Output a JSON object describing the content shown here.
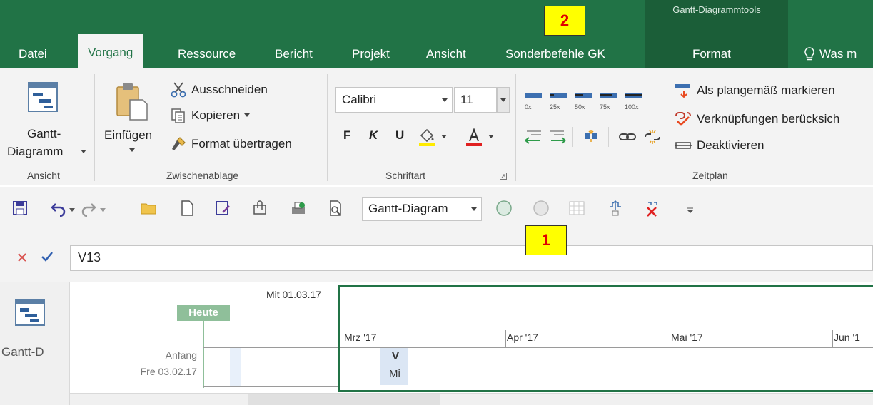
{
  "ribbon": {
    "contextual_title": "Gantt-Diagrammtools",
    "tabs": {
      "datei": "Datei",
      "vorgang": "Vorgang",
      "ressource": "Ressource",
      "bericht": "Bericht",
      "projekt": "Projekt",
      "ansicht": "Ansicht",
      "sonderbefehle": "Sonderbefehle GK",
      "format": "Format",
      "search": "Was m"
    },
    "groups": {
      "ansicht": {
        "label": "Ansicht",
        "gantt_line1": "Gantt-",
        "gantt_line2": "Diagramm"
      },
      "zwischenablage": {
        "label": "Zwischenablage",
        "einfuegen": "Einfügen",
        "ausschneiden": "Ausschneiden",
        "kopieren": "Kopieren",
        "format_uebertragen": "Format übertragen"
      },
      "schriftart": {
        "label": "Schriftart",
        "font_name": "Calibri",
        "font_size": "11",
        "bold": "F",
        "italic": "K",
        "underline": "U"
      },
      "zeitplan": {
        "label": "Zeitplan",
        "pct_labels": [
          "0x",
          "25x",
          "50x",
          "75x",
          "100x"
        ],
        "als_plangemaess": "Als plangemäß markieren",
        "verknuepfungen": "Verknüpfungen berücksich",
        "deaktivieren": "Deaktivieren"
      }
    }
  },
  "qat": {
    "view_select": "Gantt-Diagram"
  },
  "formula": {
    "value": "V13"
  },
  "timeline": {
    "heute": "Heute",
    "top_date": "Mit 01.03.17",
    "months": [
      "Mrz '17",
      "Apr '17",
      "Mai '17",
      "Jun '1"
    ],
    "anfang_label": "Anfang",
    "anfang_date": "Fre 03.02.17",
    "task_letter": "V",
    "task_day": "Mi",
    "side_label": "Gantt-D"
  },
  "annotations": {
    "marker_1": "1",
    "marker_2": "2"
  },
  "colors": {
    "accent": "#217346",
    "accent_dark": "#1b5e38",
    "heute": "#8fbf9a",
    "marker_bg": "#ffff00",
    "marker_text": "#e00000"
  }
}
